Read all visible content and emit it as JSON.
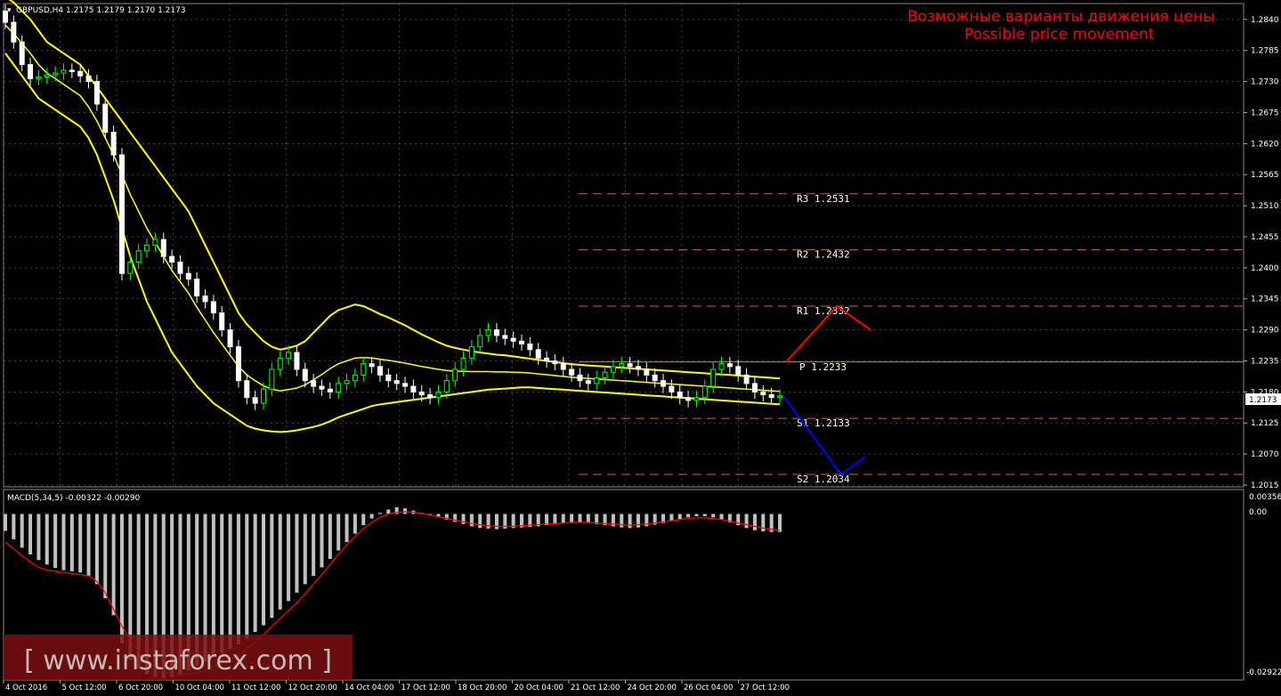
{
  "header": {
    "symbol_line": "GBPUSD,H4  1.2175 1.2179 1.2170 1.2173",
    "scenario_ru": "Возможные варианты движения цены",
    "scenario_en": "Possible price movement"
  },
  "macd": {
    "label": "MACD(5,34,5) -0.00322 -0.00290",
    "top_tick": "0.00356",
    "zero_tick": "0.00",
    "bottom_tick": "-0.02922"
  },
  "watermark": "[ www.instaforex.com ]",
  "current_price": "1.2173",
  "colors": {
    "background": "#000000",
    "grid": "#5a5a5a",
    "bull_candle": "#00ff00",
    "bear_candle": "#ffffff",
    "bollinger": "#ffff00",
    "resistance_path": "#ff0000",
    "support_path": "#0000ff",
    "level_line": "#d2691e",
    "pivot_line": "#f4c27a",
    "macd_hist": "#c0c0c0",
    "macd_signal": "#ff0000"
  },
  "chart_data": {
    "type": "line",
    "price_axis_ticks": [
      "1.2840",
      "1.2785",
      "1.2730",
      "1.2675",
      "1.2620",
      "1.2565",
      "1.2510",
      "1.2455",
      "1.2400",
      "1.2345",
      "1.2290",
      "1.2235",
      "1.2180",
      "1.2125",
      "1.2070",
      "1.2015"
    ],
    "time_axis_ticks": [
      "4 Oct 2016",
      "5 Oct 12:00",
      "6 Oct 20:00",
      "10 Oct 04:00",
      "11 Oct 12:00",
      "12 Oct 20:00",
      "14 Oct 04:00",
      "17 Oct 12:00",
      "18 Oct 20:00",
      "20 Oct 04:00",
      "21 Oct 12:00",
      "24 Oct 20:00",
      "26 Oct 04:00",
      "27 Oct 12:00"
    ],
    "ylim": [
      1.2015,
      1.2865
    ],
    "levels": [
      {
        "name": "R3",
        "label": "R3  1.2531",
        "value": 1.2531
      },
      {
        "name": "R2",
        "label": "R2  1.2432",
        "value": 1.2432
      },
      {
        "name": "R1",
        "label": "R1  1.2332",
        "value": 1.2332
      },
      {
        "name": "P",
        "label": "P  1.2233",
        "value": 1.2233
      },
      {
        "name": "S1",
        "label": "S1  1.2133",
        "value": 1.2133
      },
      {
        "name": "S2",
        "label": "S2  1.2034",
        "value": 1.2034
      }
    ],
    "close_series": [
      1.2835,
      1.28,
      1.276,
      1.2735,
      1.2738,
      1.2742,
      1.2745,
      1.275,
      1.2748,
      1.274,
      1.273,
      1.269,
      1.264,
      1.26,
      1.239,
      1.241,
      1.243,
      1.244,
      1.245,
      1.242,
      1.241,
      1.239,
      1.238,
      1.235,
      1.234,
      1.232,
      1.229,
      1.226,
      1.22,
      1.217,
      1.216,
      1.2185,
      1.222,
      1.224,
      1.225,
      1.222,
      1.22,
      1.219,
      1.2185,
      1.218,
      1.2195,
      1.22,
      1.221,
      1.223,
      1.2225,
      1.221,
      1.22,
      1.2195,
      1.219,
      1.218,
      1.2175,
      1.217,
      1.218,
      1.22,
      1.222,
      1.224,
      1.226,
      1.228,
      1.229,
      1.228,
      1.2275,
      1.227,
      1.2265,
      1.2255,
      1.224,
      1.2235,
      1.223,
      1.222,
      1.221,
      1.22,
      1.2195,
      1.2205,
      1.2215,
      1.2225,
      1.223,
      1.2225,
      1.222,
      1.221,
      1.22,
      1.219,
      1.218,
      1.217,
      1.2165,
      1.217,
      1.219,
      1.222,
      1.223,
      1.2225,
      1.221,
      1.2195,
      1.218,
      1.2175,
      1.217,
      1.2173
    ],
    "bb_upper": [
      1.288,
      1.287,
      1.2855,
      1.284,
      1.282,
      1.28,
      1.279,
      1.278,
      1.277,
      1.276,
      1.274,
      1.272,
      1.27,
      1.268,
      1.266,
      1.264,
      1.262,
      1.26,
      1.258,
      1.256,
      1.254,
      1.252,
      1.25,
      1.247,
      1.244,
      1.241,
      1.238,
      1.235,
      1.232,
      1.23,
      1.2285,
      1.227,
      1.226,
      1.2255,
      1.2258,
      1.2262,
      1.227,
      1.2285,
      1.23,
      1.2315,
      1.2325,
      1.233,
      1.2335,
      1.2332,
      1.2325,
      1.2318,
      1.2312,
      1.2305,
      1.2298,
      1.229,
      1.2282,
      1.2275,
      1.2268,
      1.2262,
      1.2258,
      1.2255,
      1.2252,
      1.225,
      1.2248,
      1.2246,
      1.2245,
      1.2243,
      1.2241,
      1.2239,
      1.2237,
      1.2235,
      1.2233,
      1.2231,
      1.2229,
      1.2228,
      1.2227,
      1.2226,
      1.2225,
      1.2224,
      1.2223,
      1.2222,
      1.2221,
      1.222,
      1.2219,
      1.2218,
      1.2217,
      1.2216,
      1.2215,
      1.2214,
      1.2213,
      1.2212,
      1.2211,
      1.221,
      1.2209,
      1.2208,
      1.2207,
      1.2206,
      1.2205,
      1.2204
    ],
    "bb_lower": [
      1.278,
      1.276,
      1.274,
      1.272,
      1.27,
      1.269,
      1.268,
      1.267,
      1.266,
      1.265,
      1.263,
      1.26,
      1.256,
      1.252,
      1.247,
      1.242,
      1.238,
      1.234,
      1.231,
      1.228,
      1.225,
      1.223,
      1.221,
      1.219,
      1.2175,
      1.216,
      1.215,
      1.214,
      1.213,
      1.212,
      1.2115,
      1.2112,
      1.211,
      1.2109,
      1.211,
      1.2112,
      1.2115,
      1.2118,
      1.2122,
      1.2128,
      1.2135,
      1.214,
      1.2145,
      1.215,
      1.2155,
      1.2158,
      1.216,
      1.2162,
      1.2164,
      1.2166,
      1.2168,
      1.217,
      1.2172,
      1.2174,
      1.2176,
      1.2178,
      1.218,
      1.2182,
      1.2184,
      1.2185,
      1.2186,
      1.2187,
      1.2188,
      1.2188,
      1.2187,
      1.2186,
      1.2185,
      1.2184,
      1.2183,
      1.2182,
      1.2181,
      1.218,
      1.2179,
      1.2178,
      1.2177,
      1.2176,
      1.2175,
      1.2174,
      1.2173,
      1.2172,
      1.2171,
      1.217,
      1.2169,
      1.2168,
      1.2167,
      1.2166,
      1.2165,
      1.2164,
      1.2163,
      1.2162,
      1.2161,
      1.216,
      1.2159,
      1.2158
    ],
    "forecast_up": [
      1.2233,
      1.2332,
      1.229
    ],
    "forecast_down": [
      1.2173,
      1.2034,
      1.2065
    ],
    "macd_hist": [
      -0.003,
      -0.0045,
      -0.006,
      -0.0072,
      -0.0082,
      -0.009,
      -0.0096,
      -0.01,
      -0.0102,
      -0.0104,
      -0.011,
      -0.0125,
      -0.015,
      -0.018,
      -0.023,
      -0.026,
      -0.0275,
      -0.0285,
      -0.029,
      -0.0292,
      -0.029,
      -0.0285,
      -0.0278,
      -0.027,
      -0.0262,
      -0.0255,
      -0.0248,
      -0.024,
      -0.0232,
      -0.0222,
      -0.021,
      -0.0198,
      -0.0185,
      -0.017,
      -0.0155,
      -0.014,
      -0.0125,
      -0.011,
      -0.0095,
      -0.008,
      -0.0065,
      -0.005,
      -0.0035,
      -0.002,
      -0.0008,
      0.0002,
      0.0008,
      0.0012,
      0.001,
      0.0006,
      0.0002,
      -0.0002,
      -0.0006,
      -0.001,
      -0.0014,
      -0.0018,
      -0.0022,
      -0.0025,
      -0.0026,
      -0.0027,
      -0.0026,
      -0.0025,
      -0.0024,
      -0.0023,
      -0.0022,
      -0.002,
      -0.0018,
      -0.0017,
      -0.0016,
      -0.0015,
      -0.0016,
      -0.0018,
      -0.002,
      -0.0022,
      -0.0024,
      -0.0025,
      -0.0024,
      -0.0022,
      -0.0019,
      -0.0016,
      -0.0012,
      -0.0009,
      -0.0006,
      -0.0004,
      -0.0004,
      -0.0006,
      -0.001,
      -0.0015,
      -0.002,
      -0.0025,
      -0.0029,
      -0.0031,
      -0.0032,
      -0.0032
    ],
    "macd_signal": [
      -0.005,
      -0.0062,
      -0.0074,
      -0.0085,
      -0.0095,
      -0.01,
      -0.0102,
      -0.0104,
      -0.0106,
      -0.0108,
      -0.011,
      -0.012,
      -0.014,
      -0.017,
      -0.02,
      -0.0225,
      -0.0245,
      -0.026,
      -0.0272,
      -0.028,
      -0.0284,
      -0.0286,
      -0.0285,
      -0.0282,
      -0.0278,
      -0.0272,
      -0.0265,
      -0.0258,
      -0.025,
      -0.024,
      -0.0228,
      -0.0215,
      -0.02,
      -0.0186,
      -0.0172,
      -0.0158,
      -0.0142,
      -0.0125,
      -0.0108,
      -0.009,
      -0.0072,
      -0.0055,
      -0.004,
      -0.0026,
      -0.0015,
      -0.0006,
      0.0,
      0.0003,
      0.0004,
      0.0003,
      0.0001,
      -0.0002,
      -0.0005,
      -0.0008,
      -0.0011,
      -0.0014,
      -0.0017,
      -0.0019,
      -0.0021,
      -0.0022,
      -0.0022,
      -0.0022,
      -0.0021,
      -0.002,
      -0.0019,
      -0.0018,
      -0.0017,
      -0.0016,
      -0.0015,
      -0.0015,
      -0.0015,
      -0.0016,
      -0.0017,
      -0.0018,
      -0.0019,
      -0.002,
      -0.0019,
      -0.0018,
      -0.0016,
      -0.0014,
      -0.0012,
      -0.001,
      -0.0008,
      -0.0007,
      -0.0007,
      -0.0008,
      -0.001,
      -0.0013,
      -0.0016,
      -0.0019,
      -0.0022,
      -0.0025,
      -0.0027,
      -0.0029
    ]
  }
}
